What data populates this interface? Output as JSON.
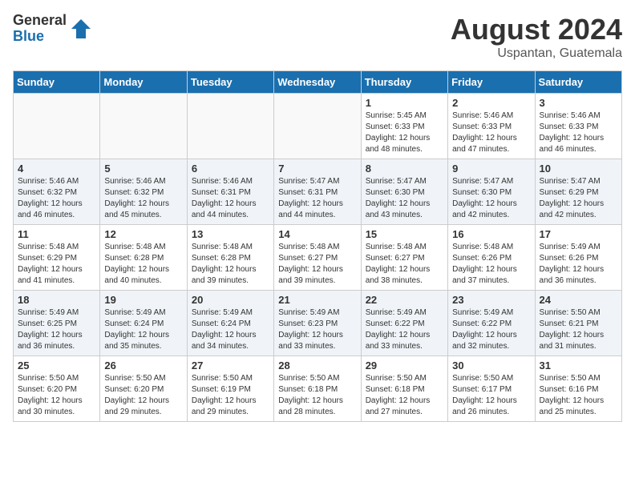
{
  "header": {
    "logo_general": "General",
    "logo_blue": "Blue",
    "month_year": "August 2024",
    "location": "Uspantan, Guatemala"
  },
  "days_of_week": [
    "Sunday",
    "Monday",
    "Tuesday",
    "Wednesday",
    "Thursday",
    "Friday",
    "Saturday"
  ],
  "weeks": [
    [
      {
        "day": "",
        "info": ""
      },
      {
        "day": "",
        "info": ""
      },
      {
        "day": "",
        "info": ""
      },
      {
        "day": "",
        "info": ""
      },
      {
        "day": "1",
        "info": "Sunrise: 5:45 AM\nSunset: 6:33 PM\nDaylight: 12 hours\nand 48 minutes."
      },
      {
        "day": "2",
        "info": "Sunrise: 5:46 AM\nSunset: 6:33 PM\nDaylight: 12 hours\nand 47 minutes."
      },
      {
        "day": "3",
        "info": "Sunrise: 5:46 AM\nSunset: 6:33 PM\nDaylight: 12 hours\nand 46 minutes."
      }
    ],
    [
      {
        "day": "4",
        "info": "Sunrise: 5:46 AM\nSunset: 6:32 PM\nDaylight: 12 hours\nand 46 minutes."
      },
      {
        "day": "5",
        "info": "Sunrise: 5:46 AM\nSunset: 6:32 PM\nDaylight: 12 hours\nand 45 minutes."
      },
      {
        "day": "6",
        "info": "Sunrise: 5:46 AM\nSunset: 6:31 PM\nDaylight: 12 hours\nand 44 minutes."
      },
      {
        "day": "7",
        "info": "Sunrise: 5:47 AM\nSunset: 6:31 PM\nDaylight: 12 hours\nand 44 minutes."
      },
      {
        "day": "8",
        "info": "Sunrise: 5:47 AM\nSunset: 6:30 PM\nDaylight: 12 hours\nand 43 minutes."
      },
      {
        "day": "9",
        "info": "Sunrise: 5:47 AM\nSunset: 6:30 PM\nDaylight: 12 hours\nand 42 minutes."
      },
      {
        "day": "10",
        "info": "Sunrise: 5:47 AM\nSunset: 6:29 PM\nDaylight: 12 hours\nand 42 minutes."
      }
    ],
    [
      {
        "day": "11",
        "info": "Sunrise: 5:48 AM\nSunset: 6:29 PM\nDaylight: 12 hours\nand 41 minutes."
      },
      {
        "day": "12",
        "info": "Sunrise: 5:48 AM\nSunset: 6:28 PM\nDaylight: 12 hours\nand 40 minutes."
      },
      {
        "day": "13",
        "info": "Sunrise: 5:48 AM\nSunset: 6:28 PM\nDaylight: 12 hours\nand 39 minutes."
      },
      {
        "day": "14",
        "info": "Sunrise: 5:48 AM\nSunset: 6:27 PM\nDaylight: 12 hours\nand 39 minutes."
      },
      {
        "day": "15",
        "info": "Sunrise: 5:48 AM\nSunset: 6:27 PM\nDaylight: 12 hours\nand 38 minutes."
      },
      {
        "day": "16",
        "info": "Sunrise: 5:48 AM\nSunset: 6:26 PM\nDaylight: 12 hours\nand 37 minutes."
      },
      {
        "day": "17",
        "info": "Sunrise: 5:49 AM\nSunset: 6:26 PM\nDaylight: 12 hours\nand 36 minutes."
      }
    ],
    [
      {
        "day": "18",
        "info": "Sunrise: 5:49 AM\nSunset: 6:25 PM\nDaylight: 12 hours\nand 36 minutes."
      },
      {
        "day": "19",
        "info": "Sunrise: 5:49 AM\nSunset: 6:24 PM\nDaylight: 12 hours\nand 35 minutes."
      },
      {
        "day": "20",
        "info": "Sunrise: 5:49 AM\nSunset: 6:24 PM\nDaylight: 12 hours\nand 34 minutes."
      },
      {
        "day": "21",
        "info": "Sunrise: 5:49 AM\nSunset: 6:23 PM\nDaylight: 12 hours\nand 33 minutes."
      },
      {
        "day": "22",
        "info": "Sunrise: 5:49 AM\nSunset: 6:22 PM\nDaylight: 12 hours\nand 33 minutes."
      },
      {
        "day": "23",
        "info": "Sunrise: 5:49 AM\nSunset: 6:22 PM\nDaylight: 12 hours\nand 32 minutes."
      },
      {
        "day": "24",
        "info": "Sunrise: 5:50 AM\nSunset: 6:21 PM\nDaylight: 12 hours\nand 31 minutes."
      }
    ],
    [
      {
        "day": "25",
        "info": "Sunrise: 5:50 AM\nSunset: 6:20 PM\nDaylight: 12 hours\nand 30 minutes."
      },
      {
        "day": "26",
        "info": "Sunrise: 5:50 AM\nSunset: 6:20 PM\nDaylight: 12 hours\nand 29 minutes."
      },
      {
        "day": "27",
        "info": "Sunrise: 5:50 AM\nSunset: 6:19 PM\nDaylight: 12 hours\nand 29 minutes."
      },
      {
        "day": "28",
        "info": "Sunrise: 5:50 AM\nSunset: 6:18 PM\nDaylight: 12 hours\nand 28 minutes."
      },
      {
        "day": "29",
        "info": "Sunrise: 5:50 AM\nSunset: 6:18 PM\nDaylight: 12 hours\nand 27 minutes."
      },
      {
        "day": "30",
        "info": "Sunrise: 5:50 AM\nSunset: 6:17 PM\nDaylight: 12 hours\nand 26 minutes."
      },
      {
        "day": "31",
        "info": "Sunrise: 5:50 AM\nSunset: 6:16 PM\nDaylight: 12 hours\nand 25 minutes."
      }
    ]
  ]
}
